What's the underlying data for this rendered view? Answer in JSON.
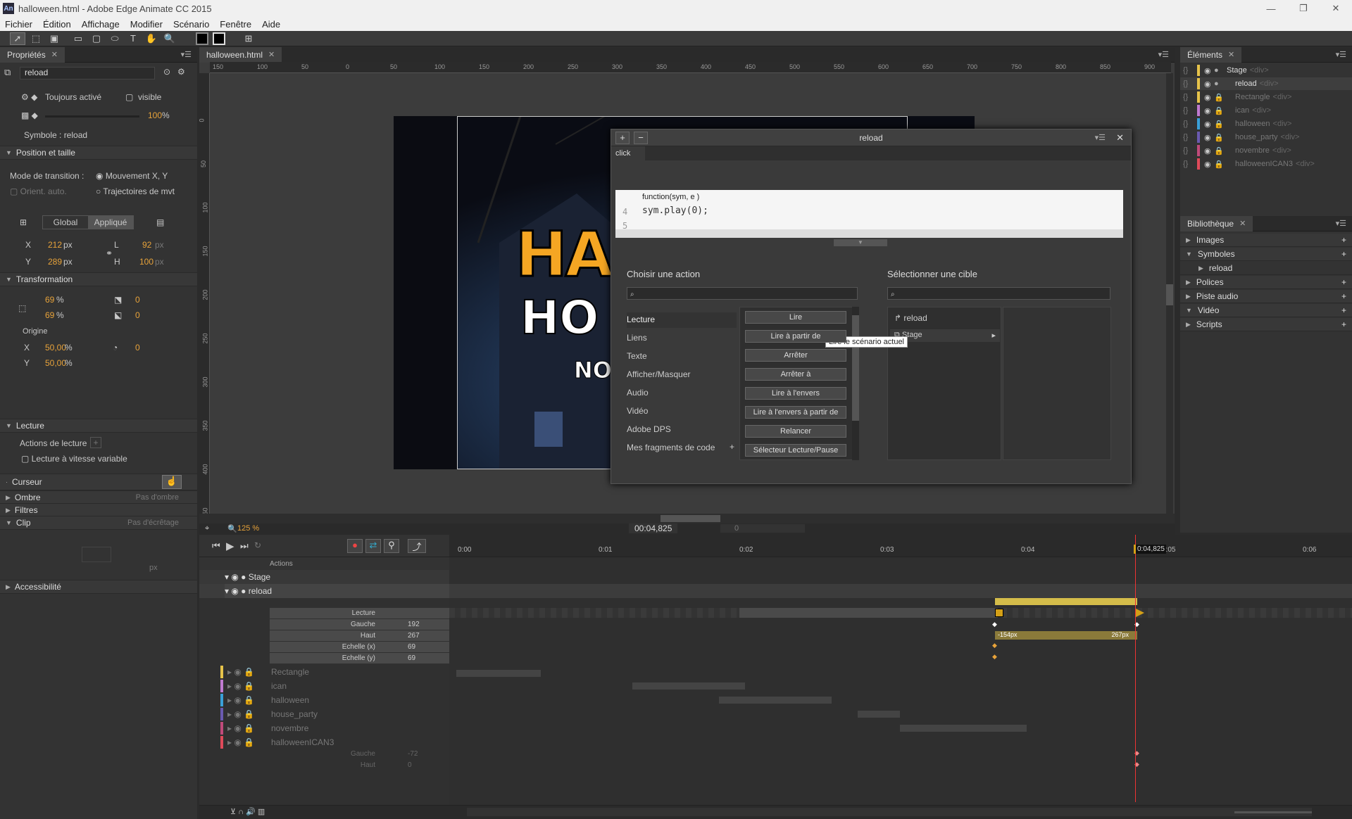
{
  "window": {
    "title": "halloween.html - Adobe Edge Animate CC 2015",
    "app_icon": "An"
  },
  "menu": [
    "Fichier",
    "Édition",
    "Affichage",
    "Modifier",
    "Scénario",
    "Fenêtre",
    "Aide"
  ],
  "props": {
    "tab": "Propriétés",
    "name_value": "reload",
    "always_on": "Toujours activé",
    "visible": "visible",
    "opacity": "100",
    "pct": "%",
    "symbol_label": "Symbole : reload",
    "pos_size": "Position et taille",
    "transition_mode": "Mode de transition :",
    "move_xy": "Mouvement X, Y",
    "orient": "Orient. auto.",
    "motion_paths": "Trajectoires de mvt",
    "global": "Global",
    "applied": "Appliqué",
    "x_label": "X",
    "x_val": "212",
    "y_label": "Y",
    "y_val": "289",
    "px": "px",
    "w_label": "L",
    "w_val": "92",
    "h_label": "H",
    "h_val": "100",
    "transformation": "Transformation",
    "scale_x": "69",
    "scale_y": "69",
    "skew_val": "0",
    "rot_val": "0",
    "origin": "Origine",
    "origin_x": "50,00",
    "origin_y": "50,00",
    "rot_origin": "0",
    "playback": "Lecture",
    "playback_actions": "Actions de lecture",
    "variable_speed": "Lecture à vitesse variable",
    "cursor": "Curseur",
    "shadow": "Ombre",
    "shadow_val": "Pas d'ombre",
    "filters": "Filtres",
    "clip": "Clip",
    "clip_val": "Pas d'écrêtage",
    "clip_px": "px",
    "accessibility": "Accessibilité"
  },
  "stage": {
    "tab": "halloween.html",
    "zoom": "125 %",
    "time": "00:04,825",
    "time2": "0",
    "ruler_h": [
      "150",
      "100",
      "50",
      "0",
      "50",
      "100",
      "150",
      "200",
      "250",
      "300",
      "350",
      "400",
      "450",
      "500",
      "550",
      "600",
      "650",
      "700",
      "750",
      "800",
      "850",
      "900"
    ],
    "ruler_v": [
      "0",
      "50",
      "100",
      "150",
      "200",
      "250",
      "300",
      "350",
      "400",
      "450"
    ],
    "title_partial": "HAL",
    "title_partial2": "HO",
    "title_partial3": "NO"
  },
  "dialog": {
    "title": "reload",
    "tab": "click",
    "code_line1": "function(sym, e )",
    "line4": "4",
    "line5": "5",
    "code": "sym.play(0);",
    "choose_action": "Choisir une action",
    "select_target": "Sélectionner une cible",
    "categories": [
      "Lecture",
      "Liens",
      "Texte",
      "Afficher/Masquer",
      "Audio",
      "Vidéo",
      "Adobe DPS",
      "Mes fragments de code"
    ],
    "actions": [
      "Lire",
      "Lire à partir de",
      "Arrêter",
      "Arrêter à",
      "Lire à l'envers",
      "Lire à l'envers à partir de",
      "Relancer",
      "Sélecteur Lecture/Pause"
    ],
    "tooltip": "Lire le scénario actuel",
    "target_reload": "reload",
    "target_stage": "Stage"
  },
  "elements": {
    "tab": "Éléments",
    "items": [
      {
        "name": "Stage",
        "tag": "<div>"
      },
      {
        "name": "reload",
        "tag": "<div>"
      },
      {
        "name": "Rectangle",
        "tag": "<div>"
      },
      {
        "name": "ican",
        "tag": "<div>"
      },
      {
        "name": "halloween",
        "tag": "<div>"
      },
      {
        "name": "house_party",
        "tag": "<div>"
      },
      {
        "name": "novembre",
        "tag": "<div>"
      },
      {
        "name": "halloweenICAN3",
        "tag": "<div>"
      }
    ]
  },
  "library": {
    "tab": "Bibliothèque",
    "items": [
      "Images",
      "Symboles",
      "reload",
      "Polices",
      "Piste audio",
      "Vidéo",
      "Scripts"
    ]
  },
  "timeline": {
    "times": [
      "0:00",
      "0:01",
      "0:02",
      "0:03",
      "0:04",
      "0:05",
      "0:06"
    ],
    "playhead": "0:04,825",
    "actions": "Actions",
    "tracks": [
      "Stage",
      "reload"
    ],
    "props": [
      {
        "l": "Lecture"
      },
      {
        "l": "Gauche",
        "v": "192"
      },
      {
        "l": "Haut",
        "v": "267"
      },
      {
        "l": "Echelle (x)",
        "v": "69"
      },
      {
        "l": "Echelle (y)",
        "v": "69"
      }
    ],
    "layers": [
      "Rectangle",
      "ican",
      "halloween",
      "house_party",
      "novembre",
      "halloweenICAN3"
    ],
    "sub": [
      {
        "l": "Gauche",
        "v": "-72"
      },
      {
        "l": "Haut",
        "v": "0"
      }
    ],
    "bar_start": "-154px",
    "bar_end": "267px"
  },
  "colors": {
    "accent": "#e8a33a",
    "yellow": "#e6c34a"
  }
}
